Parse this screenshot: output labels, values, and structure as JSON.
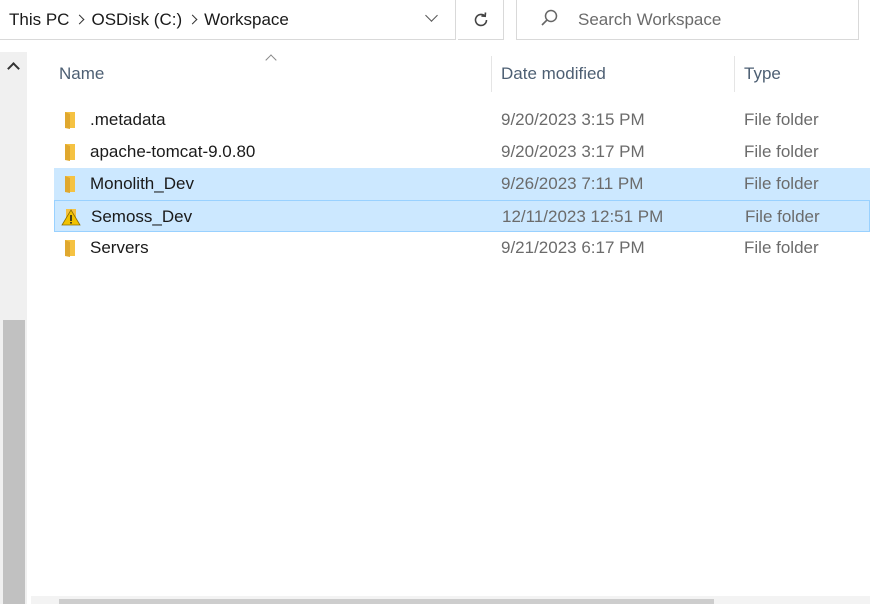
{
  "address_bar": {
    "breadcrumbs": [
      "This PC",
      "OSDisk (C:)",
      "Workspace"
    ]
  },
  "search": {
    "placeholder": "Search Workspace"
  },
  "columns": {
    "name": "Name",
    "date_modified": "Date modified",
    "type": "Type"
  },
  "files": [
    {
      "name": ".metadata",
      "date": "9/20/2023 3:15 PM",
      "type": "File folder",
      "icon": "folder-icon"
    },
    {
      "name": "apache-tomcat-9.0.80",
      "date": "9/20/2023 3:17 PM",
      "type": "File folder",
      "icon": "folder-icon"
    },
    {
      "name": "Monolith_Dev",
      "date": "9/26/2023 7:11 PM",
      "type": "File folder",
      "icon": "folder-icon",
      "selected": true
    },
    {
      "name": "Semoss_Dev",
      "date": "12/11/2023 12:51 PM",
      "type": "File folder",
      "icon": "folder-warning-icon",
      "selected": true,
      "focused": true
    },
    {
      "name": "Servers",
      "date": "9/21/2023 6:17 PM",
      "type": "File folder",
      "icon": "folder-icon"
    }
  ],
  "colors": {
    "selection": "#cce8ff",
    "focus_border": "#99d1ff",
    "folder": "#f5c242",
    "warning": "#f2c200"
  }
}
